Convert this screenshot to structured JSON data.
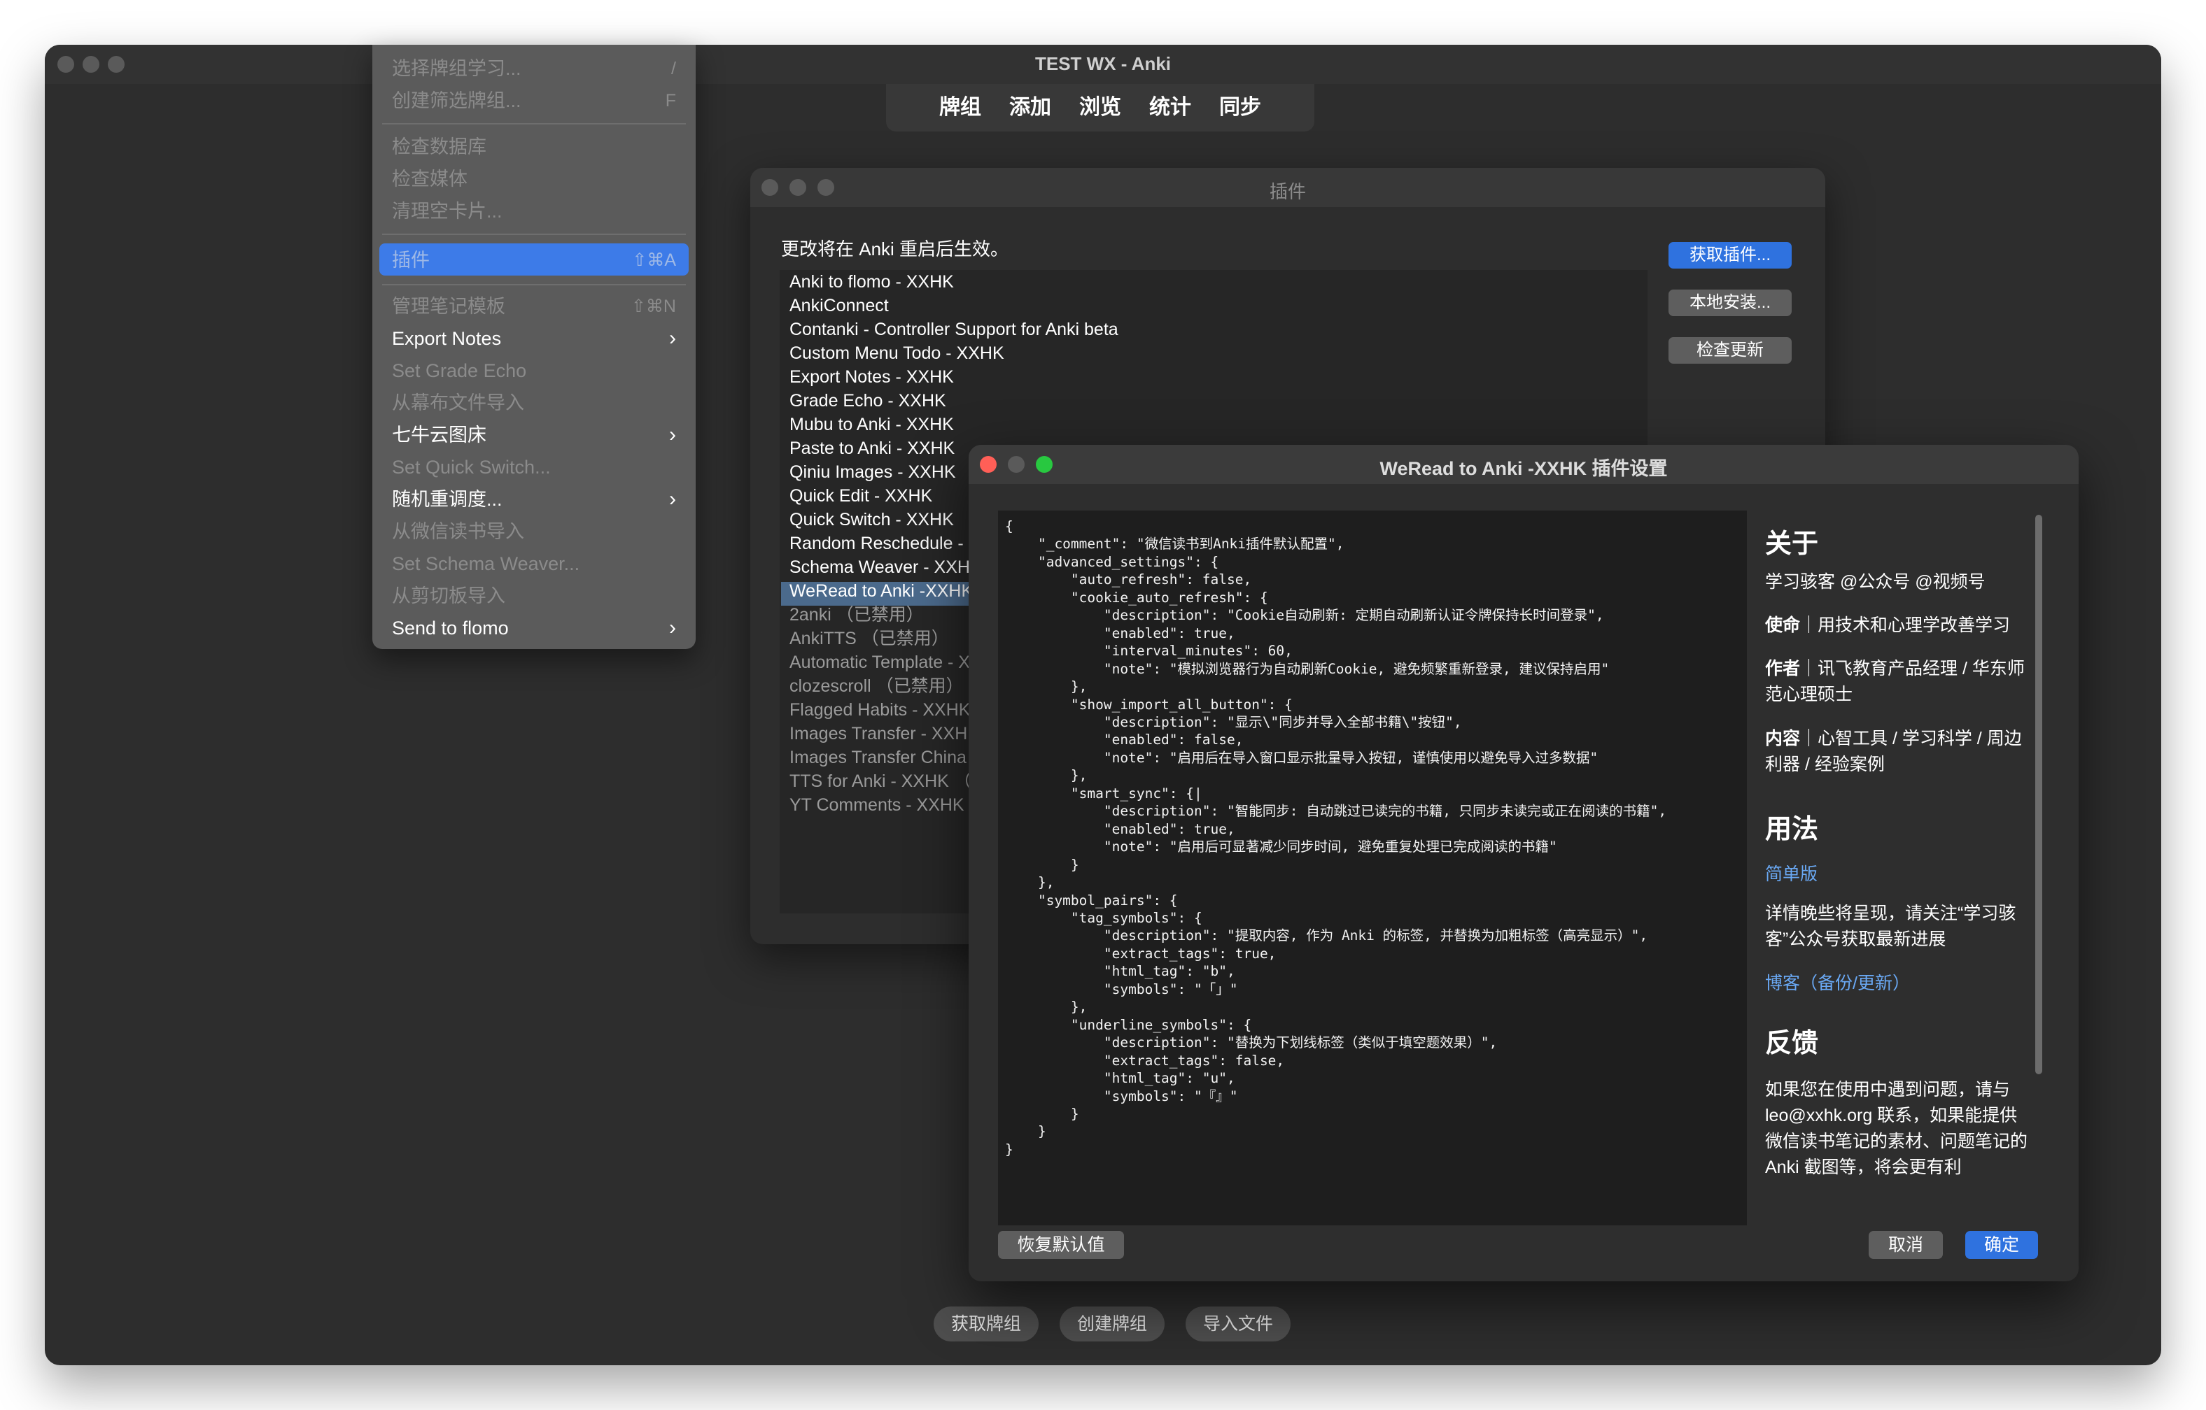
{
  "main_window": {
    "title": "TEST WX - Anki",
    "nav": [
      "牌组",
      "添加",
      "浏览",
      "统计",
      "同步"
    ],
    "bottom_buttons": [
      "获取牌组",
      "创建牌组",
      "导入文件"
    ]
  },
  "tools_menu": {
    "items": [
      {
        "label": "选择牌组学习...",
        "shortcut": "/",
        "enabled": false
      },
      {
        "label": "创建筛选牌组...",
        "shortcut": "F",
        "enabled": false
      },
      {
        "label": "检查数据库",
        "shortcut": "",
        "enabled": false
      },
      {
        "label": "检查媒体",
        "shortcut": "",
        "enabled": false
      },
      {
        "label": "清理空卡片...",
        "shortcut": "",
        "enabled": false
      },
      {
        "label": "插件",
        "shortcut": "⇧⌘A",
        "enabled": false,
        "highlighted": true
      },
      {
        "label": "管理笔记模板",
        "shortcut": "⇧⌘N",
        "enabled": false
      },
      {
        "label": "Export Notes",
        "submenu": true,
        "enabled": true
      },
      {
        "label": "Set Grade Echo",
        "enabled": false
      },
      {
        "label": "从幕布文件导入",
        "enabled": false
      },
      {
        "label": "七牛云图床",
        "submenu": true,
        "enabled": true
      },
      {
        "label": "Set Quick Switch...",
        "enabled": false
      },
      {
        "label": "随机重调度...",
        "submenu": true,
        "enabled": true
      },
      {
        "label": "从微信读书导入",
        "enabled": false
      },
      {
        "label": "Set Schema Weaver...",
        "enabled": false
      },
      {
        "label": "从剪切板导入",
        "enabled": false
      },
      {
        "label": "Send to flomo",
        "submenu": true,
        "enabled": true
      }
    ]
  },
  "addons_dialog": {
    "title": "插件",
    "notice": "更改将在 Anki 重启后生效。",
    "addons": [
      {
        "name": "Anki to flomo - XXHK",
        "enabled": true
      },
      {
        "name": "AnkiConnect",
        "enabled": true
      },
      {
        "name": "Contanki - Controller Support for Anki beta",
        "enabled": true
      },
      {
        "name": "Custom Menu Todo - XXHK",
        "enabled": true
      },
      {
        "name": "Export Notes - XXHK",
        "enabled": true
      },
      {
        "name": "Grade Echo - XXHK",
        "enabled": true
      },
      {
        "name": "Mubu to Anki - XXHK",
        "enabled": true
      },
      {
        "name": "Paste to Anki - XXHK",
        "enabled": true
      },
      {
        "name": "Qiniu Images - XXHK",
        "enabled": true
      },
      {
        "name": "Quick Edit - XXHK",
        "enabled": true
      },
      {
        "name": "Quick Switch - XXHK",
        "enabled": true
      },
      {
        "name": "Random Reschedule - X",
        "enabled": true
      },
      {
        "name": "Schema Weaver - XXH",
        "enabled": true
      },
      {
        "name": "WeRead to Anki -XXHK",
        "enabled": true,
        "selected": true
      },
      {
        "name": "2anki （已禁用）",
        "enabled": false
      },
      {
        "name": "AnkiTTS （已禁用）",
        "enabled": false
      },
      {
        "name": "Automatic Template - X",
        "enabled": false
      },
      {
        "name": "clozescroll （已禁用）",
        "enabled": false
      },
      {
        "name": "Flagged Habits - XXHK",
        "enabled": false
      },
      {
        "name": "Images Transfer - XXHI",
        "enabled": false
      },
      {
        "name": "Images Transfer China",
        "enabled": false
      },
      {
        "name": "TTS for Anki - XXHK （",
        "enabled": false
      },
      {
        "name": "YT Comments - XXHK",
        "enabled": false
      }
    ],
    "buttons": {
      "get": "获取插件...",
      "install": "本地安装...",
      "update": "检查更新"
    }
  },
  "config_dialog": {
    "title": "WeRead to Anki -XXHK 插件设置",
    "json_lines": [
      "{",
      "    \"_comment\": \"微信读书到Anki插件默认配置\",",
      "    \"advanced_settings\": {",
      "        \"auto_refresh\": false,",
      "        \"cookie_auto_refresh\": {",
      "            \"description\": \"Cookie自动刷新: 定期自动刷新认证令牌保持长时间登录\",",
      "            \"enabled\": true,",
      "            \"interval_minutes\": 60,",
      "            \"note\": \"模拟浏览器行为自动刷新Cookie, 避免频繁重新登录, 建议保持启用\"",
      "        },",
      "        \"show_import_all_button\": {",
      "            \"description\": \"显示\\\"同步并导入全部书籍\\\"按钮\",",
      "            \"enabled\": false,",
      "            \"note\": \"启用后在导入窗口显示批量导入按钮, 谨慎使用以避免导入过多数据\"",
      "        },",
      "        \"smart_sync\": {|",
      "            \"description\": \"智能同步: 自动跳过已读完的书籍, 只同步未读完或正在阅读的书籍\",",
      "            \"enabled\": true,",
      "            \"note\": \"启用后可显著减少同步时间, 避免重复处理已完成阅读的书籍\"",
      "        }",
      "    },",
      "    \"symbol_pairs\": {",
      "        \"tag_symbols\": {",
      "            \"description\": \"提取内容, 作为 Anki 的标签, 并替换为加粗标签（高亮显示）\",",
      "            \"extract_tags\": true,",
      "            \"html_tag\": \"b\",",
      "            \"symbols\": \"「」\"",
      "        },",
      "        \"underline_symbols\": {",
      "            \"description\": \"替换为下划线标签（类似于填空题效果）\",",
      "            \"extract_tags\": false,",
      "            \"html_tag\": \"u\",",
      "            \"symbols\": \"『』\"",
      "        }",
      "    }",
      "}"
    ],
    "about": {
      "about_heading": "关于",
      "about_line": "学习骇客 @公众号 @视频号",
      "mission_key": "使命",
      "mission_value": "｜用技术和心理学改善学习",
      "author_key": "作者",
      "author_value": "｜讯飞教育产品经理 / 华东师范心理硕士",
      "content_key": "内容",
      "content_value": "｜心智工具 / 学习科学 / 周边利器 / 经验案例",
      "usage_heading": "用法",
      "simple_link": "简单版",
      "usage_text": "详情晚些将呈现，请关注“学习骇客”公众号获取最新进展",
      "blog_link": "博客（备份/更新）",
      "feedback_heading": "反馈",
      "feedback_text": "如果您在使用中遇到问题，请与 leo@xxhk.org 联系，如果能提供微信读书笔记的素材、问题笔记的 Anki 截图等，将会更有利"
    },
    "buttons": {
      "restore": "恢复默认值",
      "cancel": "取消",
      "ok": "确定"
    }
  },
  "colors": {
    "accent": "#2f72df",
    "link": "#6aa9f5",
    "highlight": "#3d7be8"
  }
}
